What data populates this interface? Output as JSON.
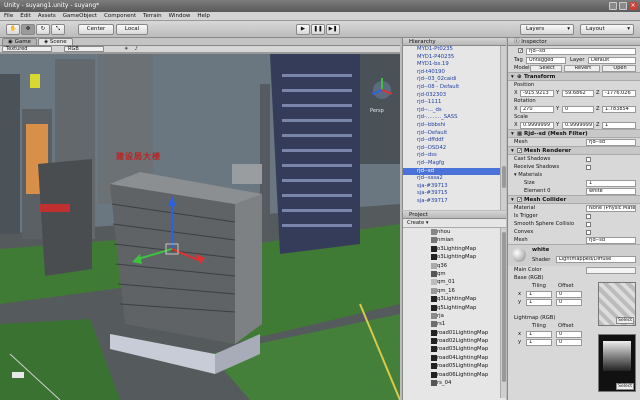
{
  "window": {
    "title": "Unity - suyang1.unity - suyang*"
  },
  "menu": [
    "File",
    "Edit",
    "Assets",
    "GameObject",
    "Component",
    "Terrain",
    "Window",
    "Help"
  ],
  "toolbar": {
    "center": "Center",
    "local": "Local",
    "layers": "Layers",
    "layout": "Layout"
  },
  "scene": {
    "tab_game": "Game",
    "tab_scene": "Scene",
    "shading": "Textured",
    "render_mode": "RGB",
    "persp_label": "Persp",
    "building_sign": "建设局大楼"
  },
  "hierarchy": {
    "title": "Hierarchy",
    "create": "Create",
    "items": [
      "MYD1-Pt0235",
      "MYD1-P40235",
      "MYD1-bs.19",
      "rjd-t40190",
      "rjd--03_02caidi",
      "rjd--08 - Default",
      "rjd-032303",
      "rjd--1111",
      "rjd--..._ds",
      "rjd-........._SASS",
      "rjd--bbbshi",
      "rjd--Default",
      "rjd--dffddf",
      "rjd--DSD42",
      "rjd--dss",
      "rjd--Magfg",
      "rjd--sd",
      "rjd--sssa2",
      "sja-#39713",
      "sja-#39715",
      "sja-#39717"
    ],
    "selected_index": 16
  },
  "project": {
    "title": "Project",
    "create": "Create",
    "items": [
      "nhou",
      "nmian",
      "o3LightingMap",
      "o3LightingMap",
      "q36",
      "qm",
      "qm_01",
      "qm_16",
      "q3LightingMap",
      "q5LightingMap",
      "rja",
      "rs1",
      "road01LightingMap",
      "road02LightingMap",
      "road03LightingMap",
      "road04LightingMap",
      "road05LightingMap",
      "road06LightingMap",
      "rs_04"
    ]
  },
  "inspector": {
    "title": "Inspector",
    "object_name": "rjd--sd",
    "tag_label": "Tag",
    "tag_value": "Untagged",
    "layer_label": "Layer",
    "layer_value": "Default",
    "model_label": "Model",
    "model_select": "Select",
    "model_revert": "Revert",
    "model_open": "Open",
    "transform": {
      "title": "Transform",
      "position_label": "Position",
      "position": [
        "-915.9213",
        "59.6862",
        "-1776.026"
      ],
      "rotation_label": "Rotation",
      "rotation": [
        "270",
        "0",
        "1.783854"
      ],
      "scale_label": "Scale",
      "scale": [
        "0.9999999",
        "0.9999999",
        "1"
      ]
    },
    "mesh_filter": {
      "title": "Rjd--sd (Mesh Filter)",
      "mesh_label": "Mesh",
      "mesh_value": "rjd--sd"
    },
    "mesh_renderer": {
      "title": "Mesh Renderer",
      "cast_shadows": "Cast Shadows",
      "receive_shadows": "Receive Shadows",
      "materials": "Materials",
      "size_label": "Size",
      "size_value": "1",
      "element0_label": "Element 0",
      "element0_value": "white"
    },
    "mesh_collider": {
      "title": "Mesh Collider",
      "material_label": "Material",
      "material_value": "None (Physic Materi",
      "is_trigger": "Is Trigger",
      "smooth_sphere": "Smooth Sphere Collisio",
      "convex": "Convex",
      "mesh_label": "Mesh",
      "mesh_value": "rjd--sd"
    },
    "material": {
      "name": "white",
      "shader_label": "Shader",
      "shader_value": "Lightmapped/Diffuse",
      "main_color": "Main Color",
      "base_label": "Base (RGB)",
      "tiling": "Tiling",
      "offset": "Offset",
      "x_label": "x",
      "y_label": "y",
      "tiling_x": "1",
      "tiling_y": "1",
      "offset_x": "0",
      "offset_y": "0",
      "select": "Select",
      "lightmap_label": "Lightmap (RGB)",
      "lm_tiling_x": "1",
      "lm_tiling_y": "1",
      "lm_offset_x": "0",
      "lm_offset_y": "0"
    }
  },
  "colors": {
    "selection": "#4a72d8",
    "sky": "#6a7680",
    "grass": "#3f7b34"
  }
}
